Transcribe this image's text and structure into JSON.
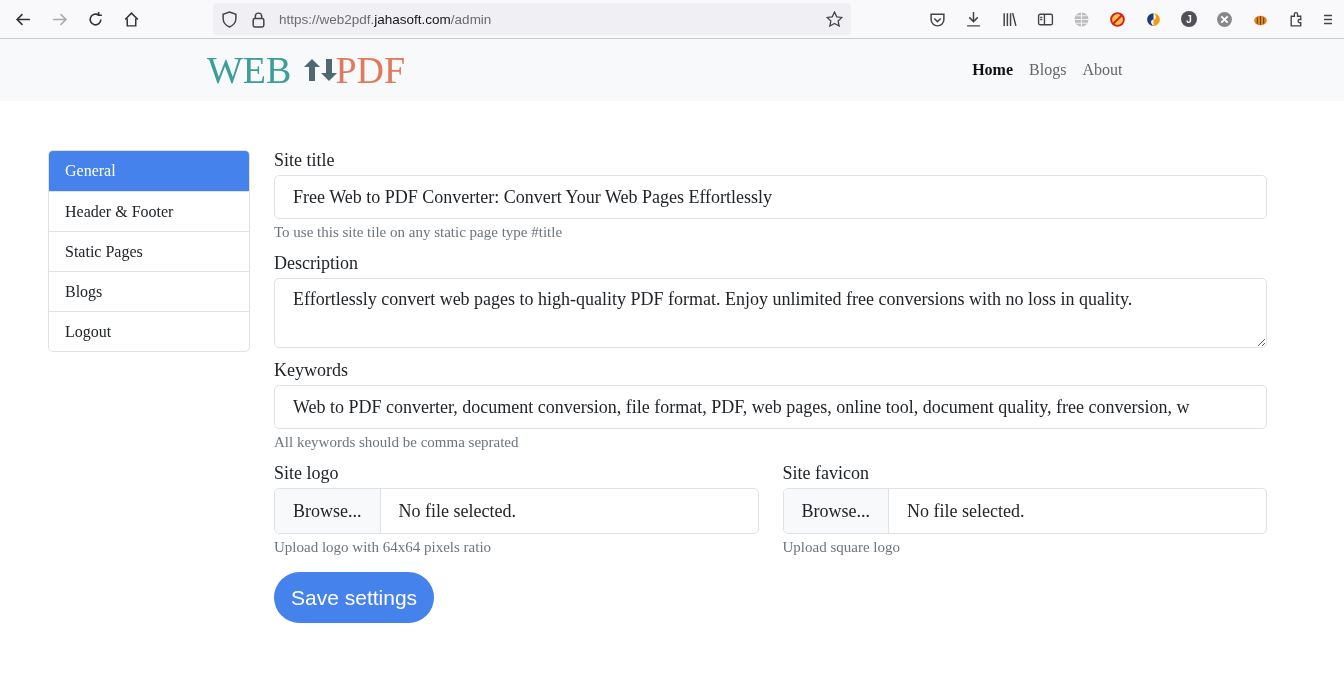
{
  "browser": {
    "url_prefix": "https://web2pdf.",
    "url_domain": "jahasoft.com",
    "url_suffix": "/admin",
    "avatar_letter": "J"
  },
  "site_header": {
    "logo_left": "WEB",
    "logo_right": "PDF",
    "nav": [
      {
        "label": "Home",
        "selected": true
      },
      {
        "label": "Blogs",
        "selected": false
      },
      {
        "label": "About",
        "selected": false
      }
    ]
  },
  "sidebar": {
    "items": [
      {
        "label": "General",
        "selected": true
      },
      {
        "label": "Header & Footer",
        "selected": false
      },
      {
        "label": "Static Pages",
        "selected": false
      },
      {
        "label": "Blogs",
        "selected": false
      },
      {
        "label": "Logout",
        "selected": false
      }
    ]
  },
  "form": {
    "fields": [
      {
        "kind": "text",
        "label": "Site title",
        "value": "Free Web to PDF Converter: Convert Your Web Pages Effortlessly",
        "help": "To use this site tile on any static page type #title"
      },
      {
        "kind": "textarea",
        "label": "Description",
        "value": "Effortlessly convert web pages to high-quality PDF format. Enjoy unlimited free conversions with no loss in quality."
      },
      {
        "kind": "text",
        "label": "Keywords",
        "value": "Web to PDF converter, document conversion, file format, PDF, web pages, online tool, document quality, free conversion, w",
        "help": "All keywords should be comma seprated"
      }
    ],
    "uploads": [
      {
        "label": "Site logo",
        "button": "Browse...",
        "status": "No file selected.",
        "help": "Upload logo with 64x64 pixels ratio"
      },
      {
        "label": "Site favicon",
        "button": "Browse...",
        "status": "No file selected.",
        "help": "Upload square logo"
      }
    ],
    "submit": "Save settings"
  }
}
